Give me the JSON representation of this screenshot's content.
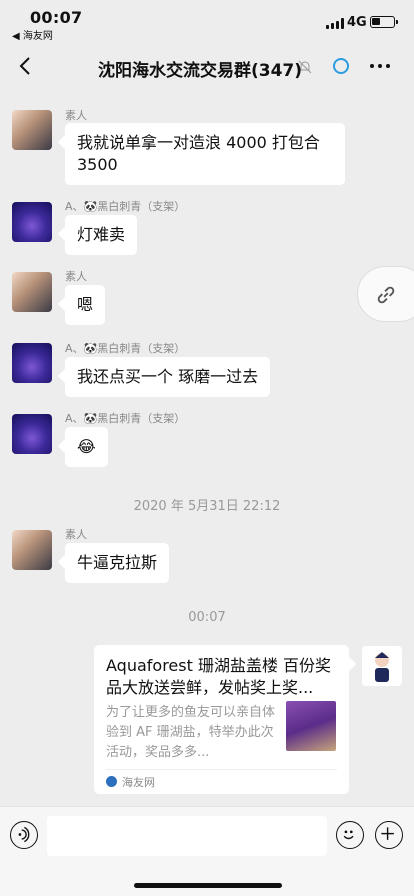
{
  "status": {
    "time": "00:07",
    "back_app": "◀ 海友网",
    "network": "4G"
  },
  "nav": {
    "title": "沈阳海水交流交易群(347)"
  },
  "messages": [
    {
      "sender": "素人",
      "text": "我就说单拿一对造浪 4000 打包合 3500",
      "avatar": "photo"
    },
    {
      "sender": "A、🐼黑白刺青（支架）",
      "text": "灯难卖",
      "avatar": "dark"
    },
    {
      "sender": "素人",
      "text": "嗯",
      "avatar": "photo"
    },
    {
      "sender": "A、🐼黑白刺青（支架）",
      "text": "我还点买一个 琢磨一过去",
      "avatar": "dark"
    },
    {
      "sender": "A、🐼黑白刺青（支架）",
      "text": "😂",
      "avatar": "dark"
    },
    {
      "sender": "素人",
      "text": "牛逼克拉斯",
      "avatar": "photo"
    }
  ],
  "timestamps": {
    "first": "2020 年 5月31日 22:12",
    "second": "00:07"
  },
  "card": {
    "title": "Aquaforest 珊湖盐盖楼 百份奖品大放送尝鲜，发帖奖上奖...",
    "description": "为了让更多的鱼友可以亲自体验到 AF 珊湖盐，特举办此次活动，奖品多多...",
    "source": "海友网"
  },
  "icons": {
    "back": "chevron-left-icon",
    "mute": "mute-bell-icon",
    "ring": "circle-icon",
    "more": "more-dots-icon",
    "link": "link-icon",
    "voice": "voice-icon",
    "emoji": "emoji-icon",
    "plus": "plus-icon"
  }
}
